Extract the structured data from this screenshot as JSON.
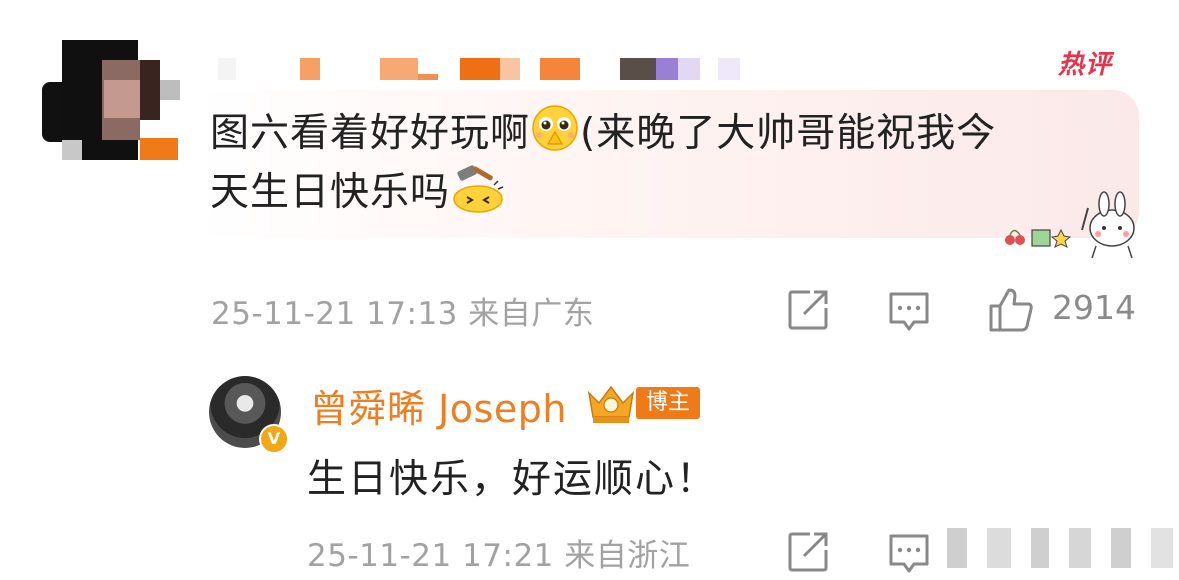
{
  "top_comment": {
    "badge": "热评",
    "text_line1": "图六看着好好玩啊",
    "text_line1b": "(来晚了大帅哥能祝我今",
    "text_line2": "天生日快乐吗",
    "emoji1": "pleading-hands-emoji",
    "emoji2": "hammer-hit-emoji",
    "meta": "25-11-21 17:13 来自广东",
    "like_count": "2914"
  },
  "reply": {
    "author": "曾舜晞 Joseph",
    "author_tag": "博主",
    "verified_mark": "V",
    "text": "生日快乐，好运顺心！",
    "meta": "25-11-21 17:21 来自浙江"
  },
  "icons": {
    "repost": "repost-icon",
    "comment": "comment-icon",
    "like": "thumbs-up-icon"
  },
  "colors": {
    "hot_badge": "#e8344a",
    "author_name": "#ef7e21",
    "author_tag_bg": "#f07a18",
    "meta_text": "#a2a2a2"
  }
}
